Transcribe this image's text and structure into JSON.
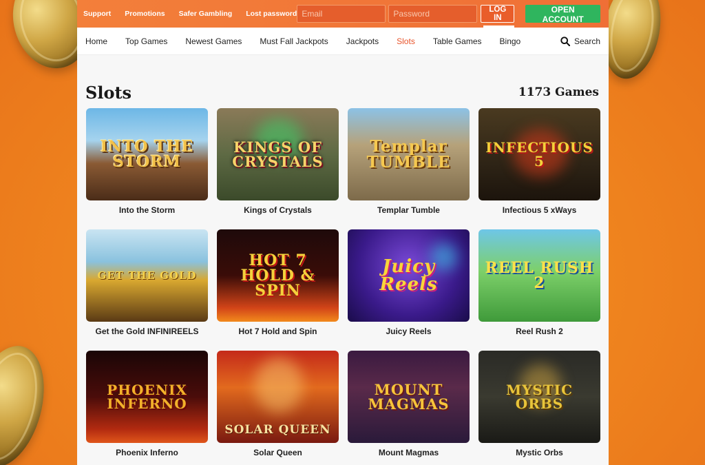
{
  "topbar": {
    "links": [
      "Support",
      "Promotions",
      "Safer Gambling",
      "Lost password"
    ],
    "email_placeholder": "Email",
    "password_placeholder": "Password",
    "login_label": "LOG IN",
    "open_account_label": "OPEN ACCOUNT"
  },
  "nav": {
    "items": [
      "Home",
      "Top Games",
      "Newest Games",
      "Must Fall Jackpots",
      "Jackpots",
      "Slots",
      "Table Games",
      "Bingo"
    ],
    "active": "Slots",
    "search_label": "Search"
  },
  "page": {
    "title": "Slots",
    "count": "1173 Games"
  },
  "games": [
    {
      "title": "Into the Storm",
      "logo": "INTO THE STORM"
    },
    {
      "title": "Kings of Crystals",
      "logo": "KINGS OF CRYSTALS"
    },
    {
      "title": "Templar Tumble",
      "logo": "Templar TUMBLE"
    },
    {
      "title": "Infectious 5 xWays",
      "logo": "INFECTIOUS 5"
    },
    {
      "title": "Get the Gold INFINIREELS",
      "logo": "GET THE GOLD"
    },
    {
      "title": "Hot 7 Hold and Spin",
      "logo": "HOT 7 HOLD & SPIN"
    },
    {
      "title": "Juicy Reels",
      "logo": "Juicy Reels"
    },
    {
      "title": "Reel Rush 2",
      "logo": "REEL RUSH 2"
    },
    {
      "title": "Phoenix Inferno",
      "logo": "PHOENIX INFERNO"
    },
    {
      "title": "Solar Queen",
      "logo": "SOLAR QUEEN"
    },
    {
      "title": "Mount Magmas",
      "logo": "MOUNT MAGMAS"
    },
    {
      "title": "Mystic Orbs",
      "logo": "MYSTIC ORBS"
    }
  ],
  "colors": {
    "accent": "#e8532a",
    "topbar": "#ef6f36",
    "open_account": "#2fb55e"
  }
}
